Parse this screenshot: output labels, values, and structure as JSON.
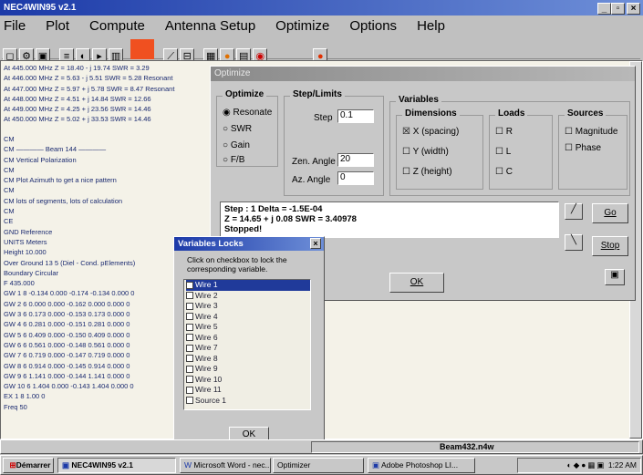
{
  "app": {
    "title": "NEC4WIN95 v2.1",
    "status_file": "Beam432.n4w"
  },
  "menu": [
    "File",
    "Plot",
    "Compute",
    "Antenna Setup",
    "Optimize",
    "Options",
    "Help"
  ],
  "results": [
    "At 445.000 MHz Z = 18.40 - j 19.74  SWR = 3.29",
    "At 446.000 MHz Z = 5.63 - j 5.51  SWR = 5.28  Resonant",
    "At 447.000 MHz Z = 5.97 + j 5.78  SWR = 8.47  Resonant",
    "At 448.000 MHz Z = 4.51 + j 14.84  SWR = 12.66",
    "At 449.000 MHz Z = 4.25 + j 23.56  SWR = 14.46",
    "At 450.000 MHz Z = 5.02 + j 33.53  SWR = 14.46"
  ],
  "listing": [
    "CM",
    "CM ———— Beam 144 ————",
    "CM         Vertical Polarization",
    "CM",
    "CM       Plot Azimuth to get a nice pattern",
    "CM",
    "CM  lots of segments, lots of calculation",
    "CM",
    "CE",
    "GND Reference",
    "UNITS Meters",
    "Height 10.000",
    "Over Ground 13 5 (Diel - Cond. pElements)",
    "Boundary Circular",
    "F 435.000",
    "GW  1  8  -0.134  0.000  -0.174  -0.134  0.000  0",
    "GW  2  6  0.000  0.000  -0.162  0.000  0.000  0",
    "GW  3  6  0.173  0.000  -0.153  0.173  0.000  0",
    "GW  4  6  0.281  0.000  -0.151  0.281  0.000  0",
    "GW  5  6  0.409  0.000  -0.150  0.409  0.000  0",
    "GW  6  6  0.561  0.000  -0.148  0.561  0.000  0",
    "GW  7  6  0.719  0.000  -0.147  0.719  0.000  0",
    "GW  8  6  0.914  0.000  -0.145  0.914  0.000  0",
    "GW  9  6  1.141  0.000  -0.144  1.141  0.000  0",
    "GW  10 6  1.404  0.000  -0.143  1.404  0.000  0",
    "EX  1  8  1.00  0",
    "Freq  50"
  ],
  "optimize": {
    "title": "Optimize",
    "group_optimize": "Optimize",
    "options": [
      "Resonate",
      "SWR",
      "Gain",
      "F/B"
    ],
    "selected": "Resonate",
    "group_step": "Step/Limits",
    "step_label": "Step",
    "step_value": "0.1",
    "zen_label": "Zen. Angle",
    "zen_value": "20",
    "az_label": "Az. Angle",
    "az_value": "0",
    "group_variables": "Variables",
    "group_dimensions": "Dimensions",
    "dimensions": [
      "X (spacing)",
      "Y (width)",
      "Z (height)"
    ],
    "group_loads": "Loads",
    "loads": [
      "R",
      "L",
      "C"
    ],
    "group_sources": "Sources",
    "sources": [
      "Magnitude",
      "Phase"
    ],
    "status_line1": "Step : 1  Delta = -1.5E-04",
    "status_line2": "Z = 14.65 + j 0.08   SWR = 3.40978",
    "status_line3": "Stopped!",
    "go": "Go",
    "stop": "Stop",
    "ok": "OK"
  },
  "locks": {
    "title": "Variables Locks",
    "instruction": "Click on checkbox to lock the corresponding variable.",
    "items": [
      "Wire 1",
      "Wire 2",
      "Wire 3",
      "Wire 4",
      "Wire 5",
      "Wire 6",
      "Wire 7",
      "Wire 8",
      "Wire 9",
      "Wire 10",
      "Wire 11",
      "Source 1"
    ],
    "ok": "OK"
  },
  "taskbar": {
    "start": "Démarrer",
    "items": [
      "NEC4WIN95 v2.1",
      "Microsoft Word - nec...",
      "Optimizer",
      "Adobe Photoshop LI..."
    ],
    "clock": "1:22 AM"
  }
}
